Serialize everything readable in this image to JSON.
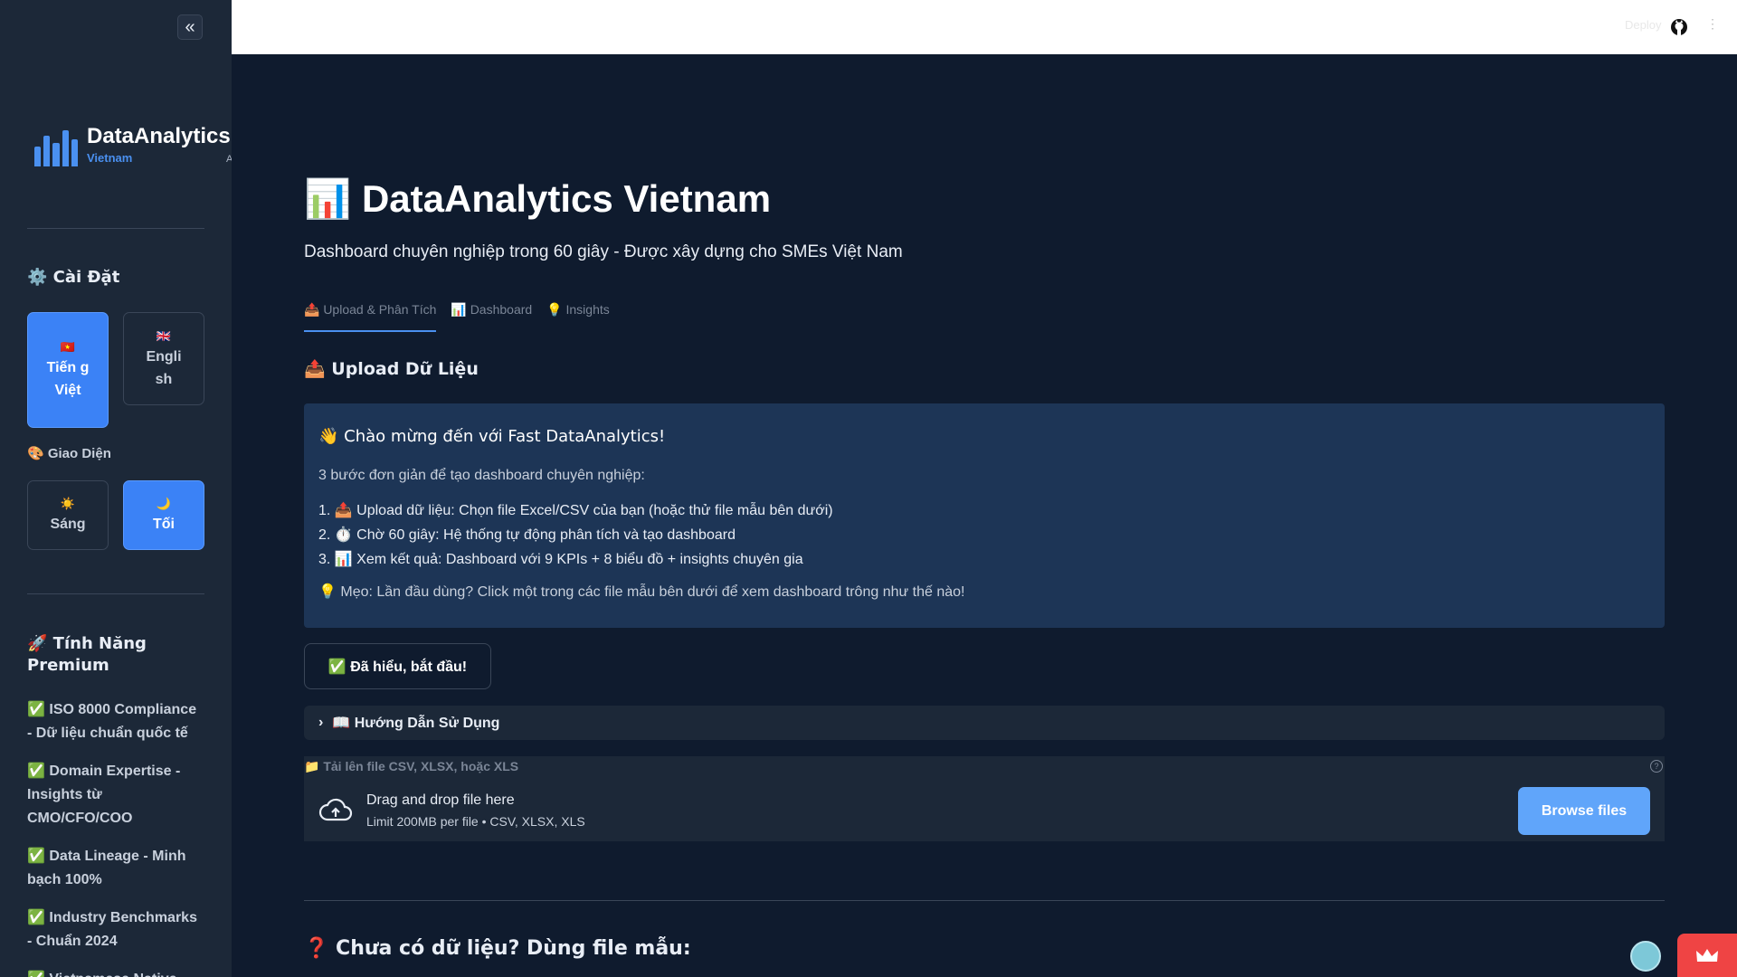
{
  "sidebar": {
    "collapse_icon": "«",
    "brand": {
      "title": "DataAnalytics",
      "subtitle": "Vietnam",
      "extra": "A"
    },
    "settings_heading": "⚙️ Cài Đặt",
    "language": {
      "options": [
        {
          "flag": "🇻🇳",
          "label": "Tiến g Việt",
          "active": true
        },
        {
          "flag": "🇬🇧",
          "label": "Engli sh",
          "active": false
        }
      ]
    },
    "theme_heading": "🎨 Giao Diện",
    "theme": {
      "options": [
        {
          "icon": "☀️",
          "label": "Sáng",
          "active": false
        },
        {
          "icon": "🌙",
          "label": "Tối",
          "active": true
        }
      ]
    },
    "premium_heading": "🚀 Tính Năng Premium",
    "features": [
      "✅ ISO 8000 Compliance - Dữ liệu chuẩn quốc tế",
      "✅ Domain Expertise - Insights từ CMO/CFO/COO",
      "✅ Data Lineage - Minh bạch 100%",
      "✅ Industry Benchmarks - Chuẩn 2024",
      "✅ Vietnamese Native"
    ]
  },
  "topbar": {
    "deploy": "Deploy",
    "menu": "⋮"
  },
  "main": {
    "title": "📊 DataAnalytics Vietnam",
    "subtitle": "Dashboard chuyên nghiệp trong 60 giây - Được xây dựng cho SMEs Việt Nam",
    "tabs": [
      {
        "label": "📤 Upload & Phân Tích",
        "active": true
      },
      {
        "label": "📊 Dashboard",
        "active": false
      },
      {
        "label": "💡 Insights",
        "active": false
      }
    ],
    "upload_heading": "📤 Upload Dữ Liệu",
    "welcome": {
      "title": "👋 Chào mừng đến với Fast DataAnalytics!",
      "intro": "3 bước đơn giản để tạo dashboard chuyên nghiệp:",
      "steps": [
        "1.  📤 Upload dữ liệu: Chọn file Excel/CSV của bạn (hoặc thử file mẫu bên dưới)",
        "2.  ⏱️ Chờ 60 giây: Hệ thống tự động phân tích và tạo dashboard",
        "3.  📊 Xem kết quả: Dashboard với 9 KPIs + 8 biểu đồ + insights chuyên gia"
      ],
      "tip": "💡 Mẹo: Lần đầu dùng? Click một trong các file mẫu bên dưới để xem dashboard trông như thế nào!"
    },
    "ok_button": "✅ Đã hiểu, bắt đầu!",
    "guide_expander": "📖 Hướng Dẫn Sử Dụng",
    "uploader": {
      "label": "📁 Tải lên file CSV, XLSX, hoặc XLS",
      "drop_text": "Drag and drop file here",
      "limit_text": "Limit 200MB per file • CSV, XLSX, XLS",
      "browse": "Browse files"
    },
    "sample_heading": "❓ Chưa có dữ liệu? Dùng file mẫu:"
  },
  "colors": {
    "accent": "#3b82f6",
    "background": "#0f1b2e",
    "sidebar": "#1c2838",
    "card": "#1d3556",
    "browse": "#60a5fa",
    "crown": "#ef4444"
  }
}
